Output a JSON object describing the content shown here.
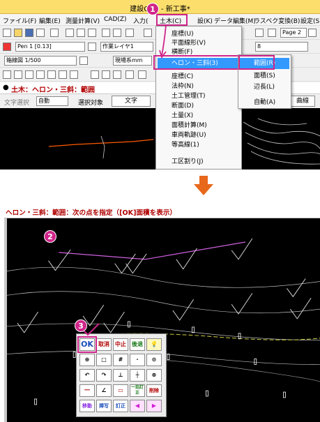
{
  "window_title": "建設CAD - 新工事*",
  "menubar": {
    "items": [
      "ファイル(F)",
      "編集(E)",
      "測量計算(V)",
      "CAD(Z)",
      "入力(",
      "土木(C)",
      "設(K)",
      "データ編集(M)",
      "ラスベク変換(B)",
      "設定(S"
    ]
  },
  "toolbar1": {
    "page_label": "Page 2"
  },
  "toolbar2": {
    "pen": "Pen 1 [0.13]",
    "layer": "作業レイヤ1",
    "linetype_num": "8"
  },
  "toolbar3": {
    "scale": "箱線図 1/500",
    "coord": "現場系mm"
  },
  "command_title": "土木：ヘロン・三斜：範囲",
  "options_bar": {
    "select_label": "文字選択",
    "select_value": "自動",
    "target_label": "選択対象",
    "text_button": "文字",
    "curve_button": "曲線"
  },
  "dropdown_menu": {
    "items": [
      "座標(U)",
      "平面線形(V)",
      "横断(F)",
      "ヘロン・三斜(3)",
      "座標(C)",
      "法枠(N)",
      "土工管理(T)",
      "断面(D)",
      "土量(X)",
      "面積計算(M)",
      "車両軌跡(U)",
      "等高線(1)",
      "工区割り(J)"
    ],
    "highlighted": "ヘロン・三斜(3)"
  },
  "submenu": {
    "items": [
      "範囲(R)",
      "面積(S)",
      "辺長(L)",
      "自動(A)"
    ],
    "highlighted": "範囲(R)"
  },
  "step_badges": [
    "1",
    "2",
    "3"
  ],
  "bottom": {
    "command_prompt": "ヘロン・三斜：範囲：次の点を指定（[OK]面積を表示）",
    "palette": {
      "row1": [
        "OK",
        "取消",
        "中止",
        "後退",
        "💡"
      ],
      "row2": [
        "⊕",
        "□",
        "#",
        "·",
        "⊙"
      ],
      "row3": [
        "↶",
        "↷",
        "⊥",
        "┼",
        "⊗"
      ],
      "row4": [
        "一",
        "∠",
        "▭",
        "一括訂正",
        "削除"
      ],
      "row5": [
        "移動",
        "挿写",
        "訂正",
        "◀",
        "▶"
      ]
    }
  },
  "colors": {
    "accent": "#d0258a",
    "title": "#fbde6c",
    "command_red": "#b00000",
    "highlight": "#3399ff"
  }
}
